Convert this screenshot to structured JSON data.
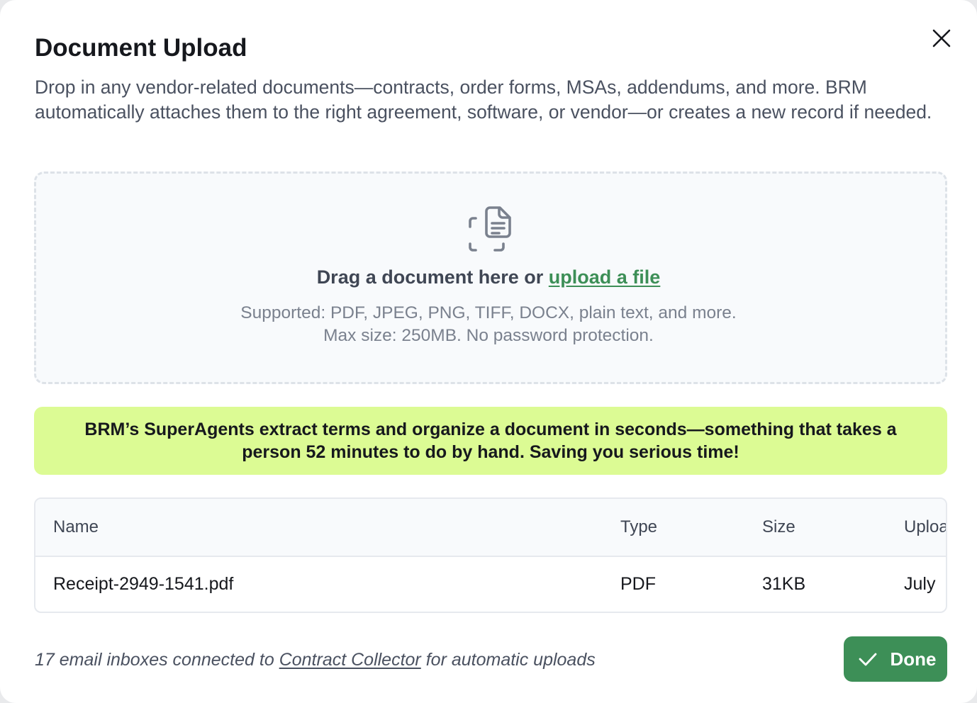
{
  "modal": {
    "title": "Document Upload",
    "description": "Drop in any vendor-related documents—contracts, order forms, MSAs, addendums, and more. BRM automatically attaches them to the right agreement, software, or vendor—or creates a new record if needed.",
    "close_icon": "close-icon"
  },
  "dropzone": {
    "icon": "document-scan-icon",
    "prompt": "Drag a document here or",
    "link_label": "upload a file",
    "supported": "Supported: PDF, JPEG, PNG, TIFF, DOCX, plain text, and more.",
    "max_size": "Max size: 250MB. No password protection."
  },
  "banner": {
    "text": "BRM’s SuperAgents extract terms and organize a document in seconds—something that takes a person 52 minutes to do by hand. Saving you serious time!",
    "color": "#dcfb94"
  },
  "table": {
    "columns": [
      "Name",
      "Type",
      "Size",
      "Uploa"
    ],
    "rows": [
      [
        "Receipt-2949-1541.pdf",
        "PDF",
        "31KB",
        "July"
      ]
    ]
  },
  "footer": {
    "note_prefix": "17 email inboxes connected to",
    "note_link": "Contract Collector",
    "note_suffix": "for automatic uploads",
    "done_label": "Done",
    "done_icon": "check-icon",
    "accent_color": "#3d8f57"
  }
}
